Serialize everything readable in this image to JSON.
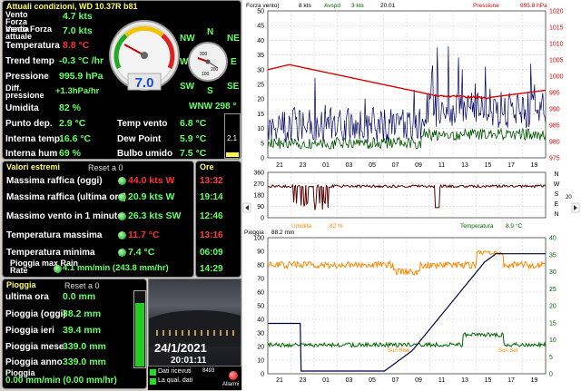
{
  "current": {
    "title": "Attuali condizioni, WD 10.37R b81",
    "rows": [
      {
        "label": "Vento Forza media",
        "value": "4.7 kts"
      },
      {
        "label": "Vento Forza attuale",
        "value": "7.0 kts"
      },
      {
        "label": "Temperatura",
        "value": "8.8 °C"
      },
      {
        "label": "Trend temp",
        "value": "-0.3 °C /hr"
      },
      {
        "label": "Pressione",
        "value": "995.9 hPa"
      },
      {
        "label": "Diff. pressione",
        "value": "+1.3hPa/hr"
      },
      {
        "label": "Umidita",
        "value": "82 %"
      },
      {
        "label": "Punto dep.",
        "value": "2.9 °C"
      },
      {
        "label": "Interna temp.",
        "value": "16.6 °C"
      },
      {
        "label": "Interna hum",
        "value": "69 %"
      }
    ],
    "right_rows": [
      {
        "label": "Temp vento",
        "value": "6.8 °C"
      },
      {
        "label": "Dew Point",
        "value": "5.9 °C"
      },
      {
        "label": "Bulbo umido",
        "value": "7.5 °C"
      }
    ],
    "wind_dir": "WNW 298 °",
    "gauge_value": "7.0",
    "gauge_small": [
      "300",
      "200",
      "100"
    ],
    "compass": [
      "NW",
      "N",
      "NE",
      "W",
      "E",
      "SW",
      "S",
      "SE"
    ],
    "side_value": "2.1"
  },
  "extremes": {
    "title": "Valori estremi",
    "reset": "Reset a 0",
    "rows": [
      {
        "label": "Massima raffica (oggi)",
        "value": "44.0 kts W"
      },
      {
        "label": "Massima raffica (ultima ora)",
        "value": "20.9 kts  W"
      },
      {
        "label": "Massimo vento in 1 minuto",
        "value": "26.3 kts SW"
      },
      {
        "label": "Temperatura massima",
        "value": "11.7 °C"
      },
      {
        "label": "Temperatura minima",
        "value": "7.4 °C"
      },
      {
        "label": "Pioggia max Rain Rate",
        "value": "4.1 mm/min (243.8 mm/hr)"
      }
    ],
    "ore_title": "Ore",
    "times": [
      "13:32",
      "19:14",
      "12:46",
      "13:16",
      "06:09",
      "14:29"
    ]
  },
  "rain": {
    "title": "Pioggia",
    "reset": "Reset a 0",
    "rows": [
      {
        "label": "ultima ora",
        "value": "0.0 mm"
      },
      {
        "label": "Pioggia (oggi)",
        "value": "88.2 mm"
      },
      {
        "label": "Pioggia ieri",
        "value": "39.4 mm"
      },
      {
        "label": "Pioggia mese",
        "value": "339.0 mm"
      },
      {
        "label": "Pioggia anno",
        "value": "339.0 mm"
      }
    ],
    "rate_label": "Pioggia",
    "rate_value": "0.00 mm/min (0.00 mm/hr)"
  },
  "webcam": {
    "date": "24/1/2021",
    "time": "20:01:11"
  },
  "status": {
    "dati_ricevuti": "Dati ricevuti",
    "qual_dati": "La qual. dati",
    "count": "8493",
    "allarme": "Allarmi"
  },
  "graph": {
    "top_legend": [
      "Forza vento)",
      "8 kts",
      "Avspd",
      "3 kts",
      "20.01",
      "Pressione",
      "995.8 hPa"
    ],
    "top_left_ticks": [
      "50",
      "45",
      "40",
      "35",
      "30",
      "25",
      "20",
      "15",
      "10",
      "5",
      "0"
    ],
    "top_right_ticks": [
      "1020",
      "1015",
      "1010",
      "1005",
      "1000",
      "995",
      "990",
      "985",
      "980",
      "975"
    ],
    "x_labels": [
      "21",
      "23",
      "01",
      "03",
      "05",
      "07",
      "09",
      "11",
      "13",
      "15",
      "17",
      "19"
    ],
    "mid_ticks": [
      "360",
      "270",
      "180",
      "90",
      "0"
    ],
    "dir_letters": [
      "N",
      "W",
      "S",
      "E",
      "N"
    ],
    "mid_right": "20",
    "mid_legend": [
      "Umidita",
      "82 %",
      "Temperatura",
      "8.9 °C"
    ],
    "bot_legend": [
      "Pioggia",
      "88.2 mm"
    ],
    "bot_left_ticks": [
      "100",
      "90",
      "80",
      "70",
      "60",
      "50",
      "40",
      "30",
      "20",
      "10",
      "0"
    ],
    "bot_right_ticks": [
      "40",
      "35",
      "30",
      "25",
      "20",
      "15",
      "10",
      "5",
      "0"
    ],
    "sun_rise": "Sun Rise",
    "sun_set": "Sun Set"
  },
  "colors": {
    "wind": "#000066",
    "avg_wind": "#005500",
    "pressure": "#dd0000",
    "humidity": "#ff8800",
    "temperature": "#006600",
    "rain": "#000044",
    "dir": "#550000"
  }
}
